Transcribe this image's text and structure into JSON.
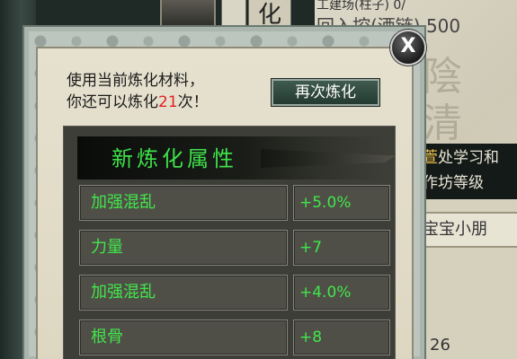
{
  "background": {
    "tab_glyph": "化",
    "top_line": "工建场(柱子) 0/",
    "line_1": "回入控(酒链) 500",
    "calligraphy": "陰 清 今",
    "mid_line_1_gold": "萱",
    "mid_line_1": "处学习和",
    "mid_line_2": "作坊等级",
    "lower_item": "宝宝小朋",
    "lower_num": "26"
  },
  "dialog": {
    "close_label": "X",
    "info_line_1": "使用当前炼化材料，",
    "info_line_2_prefix": "你还可以炼化",
    "info_count": "21",
    "info_line_2_suffix": "次！",
    "refine_button": "再次炼化",
    "attributes_title": "新炼化属性",
    "attributes": [
      {
        "name": "加强混乱",
        "value": "+5.0%"
      },
      {
        "name": "力量",
        "value": "+7"
      },
      {
        "name": "加强混乱",
        "value": "+4.0%"
      },
      {
        "name": "根骨",
        "value": "+8"
      }
    ]
  },
  "colors": {
    "attribute_text": "#42e64a",
    "count_highlight": "#e02020",
    "button_bg": "#2f4a3f"
  }
}
